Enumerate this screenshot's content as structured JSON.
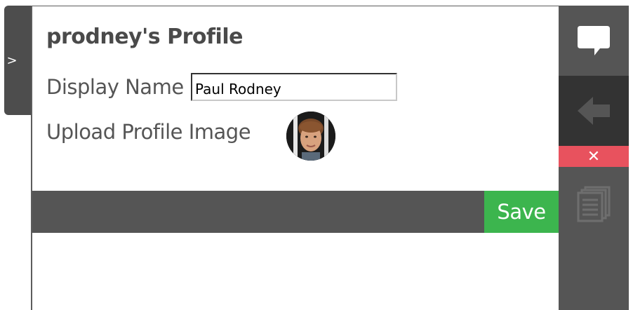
{
  "collapse_tab": {
    "label": ">"
  },
  "profile": {
    "title": "prodney's Profile",
    "display_name_label": "Display Name",
    "display_name_value": "Paul Rodney",
    "upload_label": "Upload Profile Image"
  },
  "actions": {
    "save_label": "Save"
  },
  "sidebar": {
    "close_label": "✕"
  },
  "colors": {
    "accent_green": "#3cb54e",
    "close_red": "#e8525e",
    "dark_gray": "#555555",
    "darker_gray": "#333333"
  }
}
